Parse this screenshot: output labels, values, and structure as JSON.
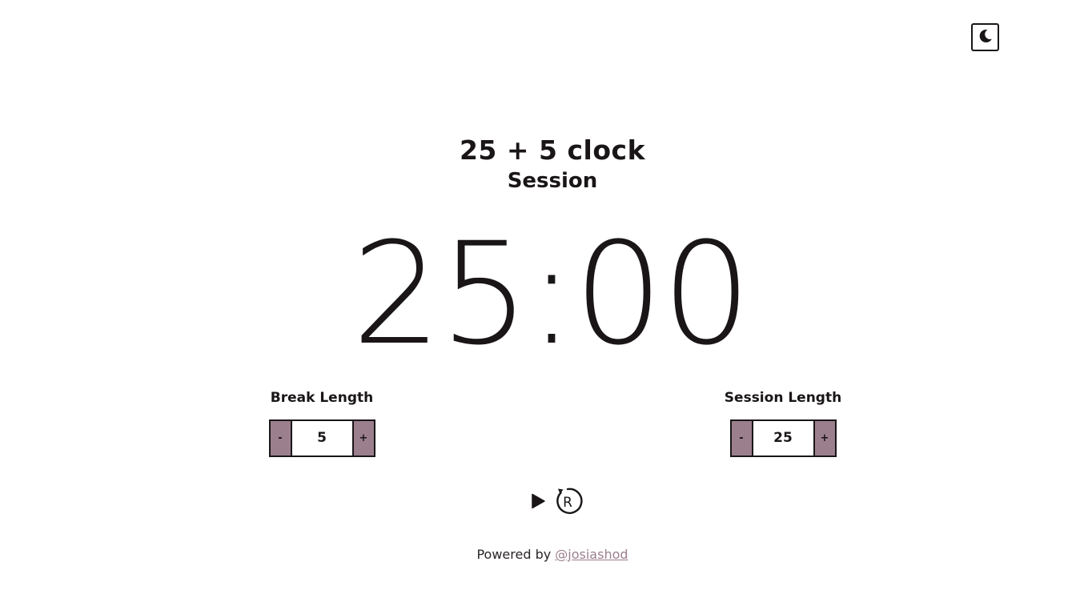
{
  "theme_toggle": {
    "icon": "moon-icon"
  },
  "header": {
    "title": "25 + 5 clock",
    "timer_label": "Session"
  },
  "timer": {
    "time_left": "25:00"
  },
  "break_control": {
    "label": "Break Length",
    "decrement_label": "-",
    "value": "5",
    "increment_label": "+"
  },
  "session_control": {
    "label": "Session Length",
    "decrement_label": "-",
    "value": "25",
    "increment_label": "+"
  },
  "actions": {
    "play_icon": "play-icon",
    "reset_icon": "reset-icon",
    "reset_letter": "R"
  },
  "footer": {
    "prefix": "Powered by ",
    "link_text": "@josiashod"
  },
  "colors": {
    "accent": "#9c7f8d",
    "text": "#1a1618",
    "background": "#ffffff"
  }
}
